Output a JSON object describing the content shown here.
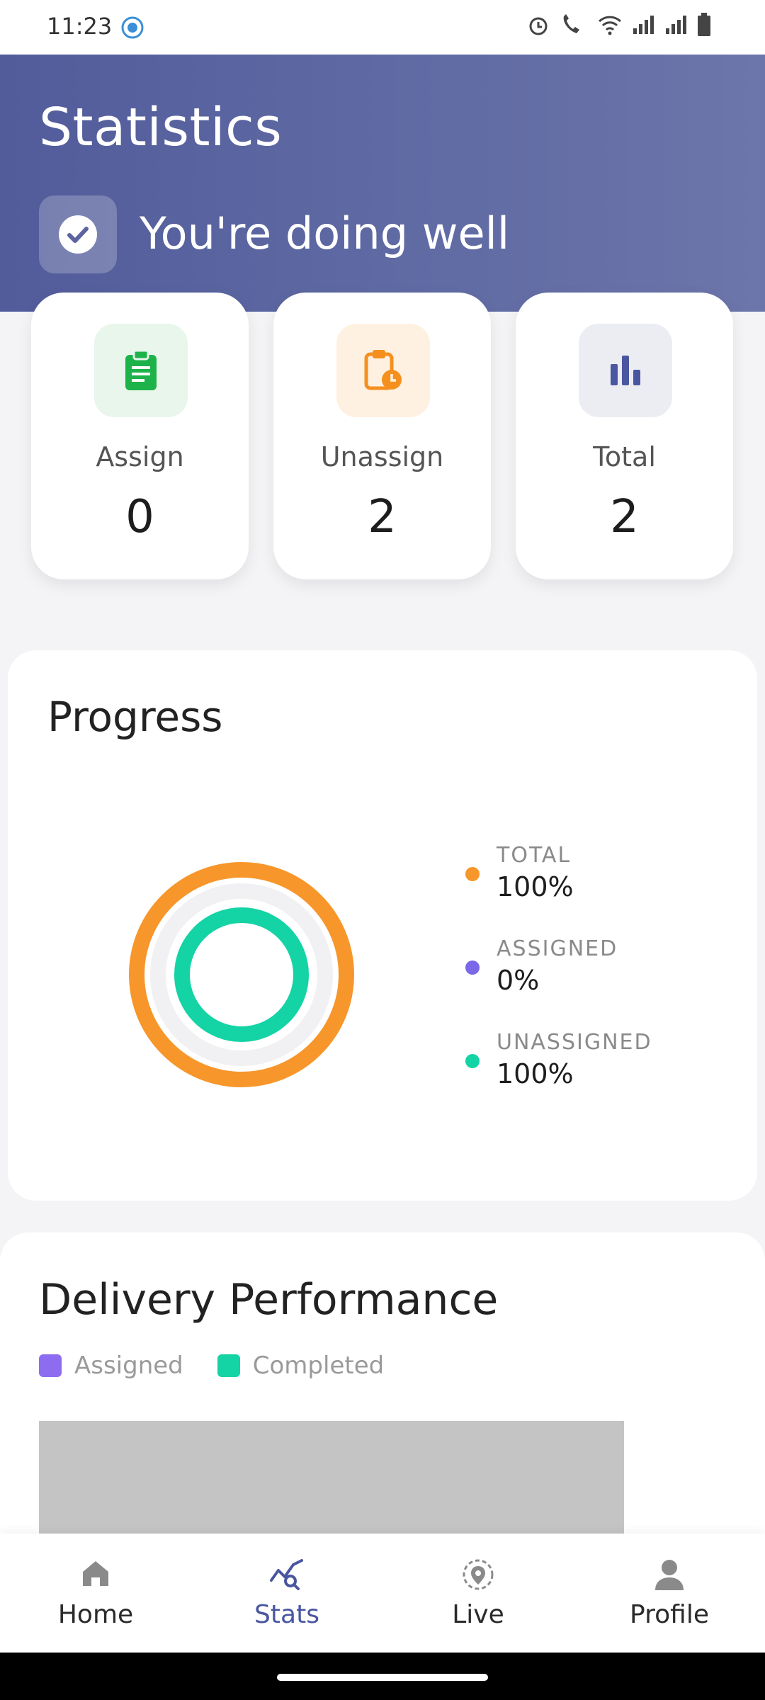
{
  "status_bar": {
    "time": "11:23"
  },
  "header": {
    "title": "Statistics",
    "subtitle": "You're doing well"
  },
  "stats": [
    {
      "label": "Assign",
      "value": "0",
      "icon": "clipboard-icon",
      "color": "#1db34a",
      "bg": "#e8f6ec"
    },
    {
      "label": "Unassign",
      "value": "2",
      "icon": "clipboard-clock-icon",
      "color": "#f5901f",
      "bg": "#fff1e2"
    },
    {
      "label": "Total",
      "value": "2",
      "icon": "bar-chart-icon",
      "color": "#4a56a0",
      "bg": "#ececf3"
    }
  ],
  "progress": {
    "title": "Progress",
    "legend": [
      {
        "label": "TOTAL",
        "value": "100%",
        "color": "#f7962a"
      },
      {
        "label": "ASSIGNED",
        "value": "0%",
        "color": "#7b68e8"
      },
      {
        "label": "UNASSIGNED",
        "value": "100%",
        "color": "#14d3a5"
      }
    ]
  },
  "delivery_performance": {
    "title": "Delivery Performance",
    "legend": [
      {
        "label": "Assigned",
        "color": "#8d6cf0"
      },
      {
        "label": "Completed",
        "color": "#14d3a5"
      }
    ]
  },
  "bottom_nav": {
    "items": [
      {
        "label": "Home",
        "icon": "home-icon",
        "active": false
      },
      {
        "label": "Stats",
        "icon": "stats-icon",
        "active": true
      },
      {
        "label": "Live",
        "icon": "location-pin-icon",
        "active": false
      },
      {
        "label": "Profile",
        "icon": "person-icon",
        "active": false
      }
    ]
  }
}
